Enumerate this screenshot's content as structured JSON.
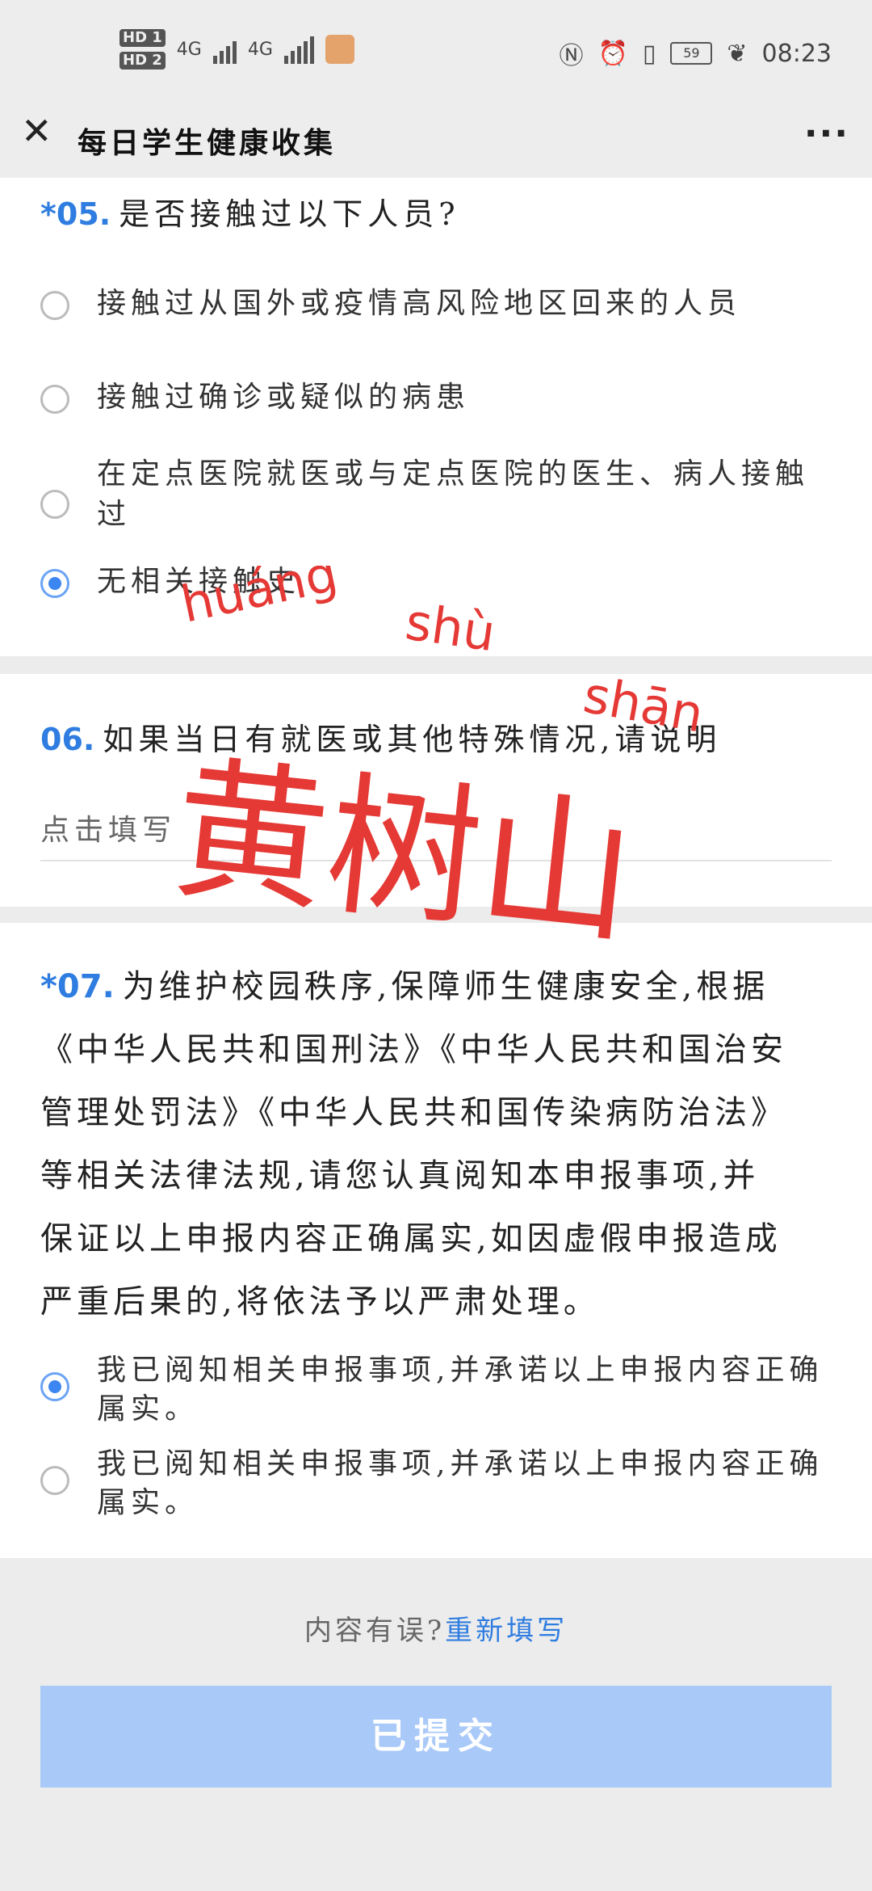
{
  "status": {
    "hd1": "HD 1",
    "hd2": "HD 2",
    "net1": "4G",
    "net2": "4G",
    "battery": "59",
    "time": "08:23"
  },
  "header": {
    "title": "每日学生健康收集",
    "more": "···"
  },
  "q05": {
    "number": "*05.",
    "title": "是否接触过以下人员?",
    "options": [
      {
        "label": "接触过从国外或疫情高风险地区回来的人员",
        "checked": false
      },
      {
        "label": "接触过确诊或疑似的病患",
        "checked": false
      },
      {
        "label": "在定点医院就医或与定点医院的医生、病人接触过",
        "checked": false
      },
      {
        "label": "无相关接触史",
        "checked": true
      }
    ]
  },
  "q06": {
    "number": "06.",
    "title": "如果当日有就医或其他特殊情况,请说明",
    "placeholder": "点击填写"
  },
  "q07": {
    "number": "*07.",
    "lines": [
      "为维护校园秩序,保障师生健康安全,根据",
      "《中华人民共和国刑法》《中华人民共和国治安",
      "管理处罚法》《中华人民共和国传染病防治法》",
      "等相关法律法规,请您认真阅知本申报事项,并",
      "保证以上申报内容正确属实,如因虚假申报造成",
      "严重后果的,将依法予以严肃处理。"
    ],
    "options": [
      {
        "label": "我已阅知相关申报事项,并承诺以上申报内容正确属实。",
        "checked": true
      },
      {
        "label": "我已阅知相关申报事项,并承诺以上申报内容正确属实。",
        "checked": false
      }
    ]
  },
  "footer": {
    "prompt": "内容有误?",
    "redo": "重新填写",
    "submit": "已提交"
  },
  "watermark": {
    "text": "黄树山",
    "pinyin1": "huáng",
    "pinyin2": "shù",
    "pinyin3": "shān",
    "color": "#e53935"
  }
}
